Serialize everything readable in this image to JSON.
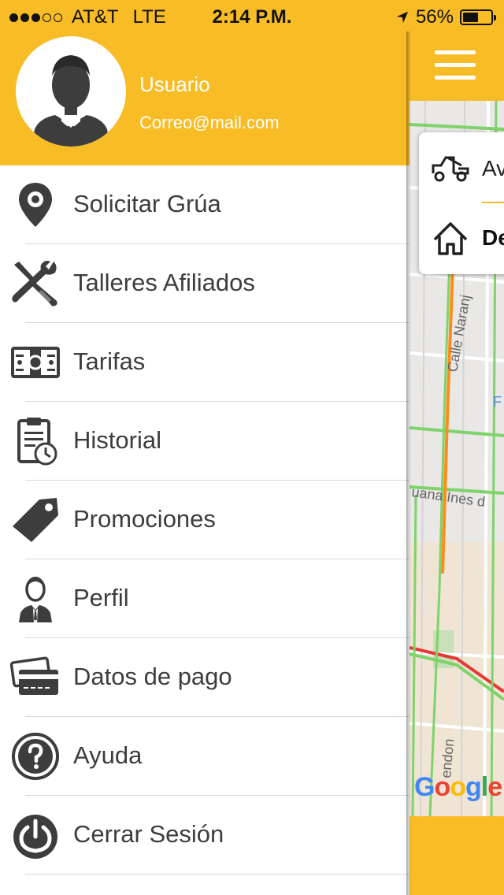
{
  "status_bar": {
    "carrier": "AT&T",
    "network": "LTE",
    "time": "2:14 P.M.",
    "battery": "56%",
    "battery_level": 0.56,
    "signal_bars_filled": 3,
    "signal_bars_total": 5
  },
  "drawer": {
    "user": {
      "name": "Usuario",
      "email": "Correo@mail.com"
    },
    "menu": [
      {
        "label": "Solicitar Grúa",
        "icon": "map-pin-icon"
      },
      {
        "label": "Talleres Afiliados",
        "icon": "tools-icon"
      },
      {
        "label": "Tarifas",
        "icon": "money-icon"
      },
      {
        "label": "Historial",
        "icon": "clipboard-clock-icon"
      },
      {
        "label": "Promociones",
        "icon": "tag-icon"
      },
      {
        "label": "Perfil",
        "icon": "person-icon"
      },
      {
        "label": "Datos de pago",
        "icon": "credit-card-icon"
      },
      {
        "label": "Ayuda",
        "icon": "help-icon"
      },
      {
        "label": "Cerrar Sesión",
        "icon": "power-icon"
      }
    ]
  },
  "map_screen": {
    "origin_text": "Av",
    "destination_text": "De",
    "street_labels": [
      "Calle Naranj",
      "uana Ines d",
      "endon",
      "F"
    ],
    "map_attribution": "Google"
  },
  "colors": {
    "accent": "#f8bc27",
    "icon": "#3d3d3d",
    "text": "#3d3d3d"
  }
}
